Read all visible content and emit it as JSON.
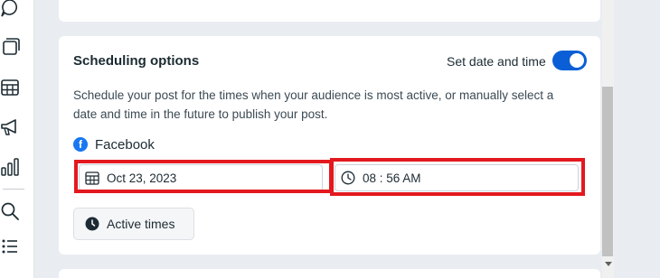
{
  "sidebar": {
    "icons": [
      "chat-bubble-icon",
      "content-stack-icon",
      "planner-calendar-icon",
      "megaphone-icon",
      "insights-bar-chart-icon",
      "search-icon",
      "list-icon"
    ]
  },
  "scheduling": {
    "title": "Scheduling options",
    "toggle_label": "Set date and time",
    "toggle_on": true,
    "description": "Schedule your post for the times when your audience is most active, or manually select a date and time in the future to publish your post.",
    "platform": "Facebook",
    "date_value": "Oct 23, 2023",
    "time_value": "08 : 56 AM",
    "active_times_label": "Active times"
  },
  "colors": {
    "accent": "#0a5fd6",
    "highlight": "#e3191f",
    "facebook": "#1877f2"
  }
}
